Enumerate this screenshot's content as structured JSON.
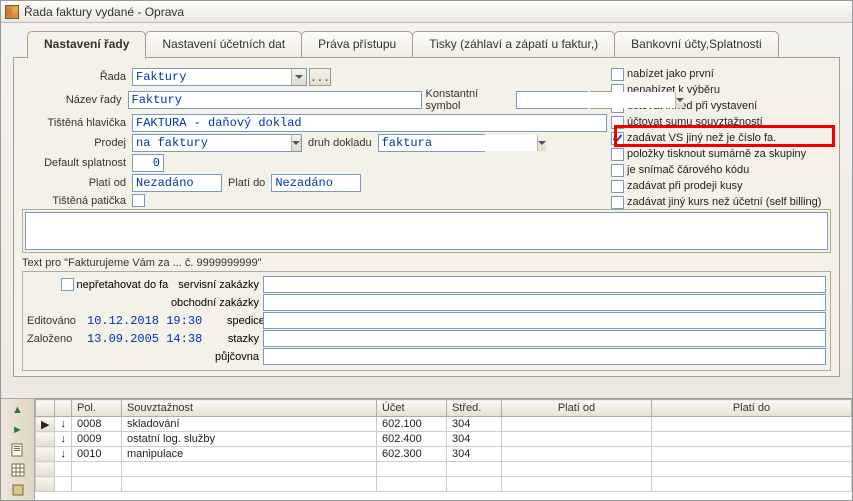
{
  "window_title": "Řada faktury vydané - Oprava",
  "tabs": [
    {
      "label": "Nastavení řady"
    },
    {
      "label": "Nastavení účetních dat"
    },
    {
      "label": "Práva přístupu"
    },
    {
      "label": "Tisky (záhlaví a zápatí u faktur,)"
    },
    {
      "label": "Bankovní účty,Splatnosti"
    }
  ],
  "labels": {
    "rada": "Řada",
    "nazev": "Název řady",
    "tistena": "Tištěná hlavička",
    "prodej": "Prodej",
    "default_splatnost": "Default splatnost",
    "plati_od": "Platí od",
    "plati_do": "Platí do",
    "tistena_paticka": "Tištěná patička",
    "konst_symbol": "Konstantní symbol",
    "druh_dokladu": "druh dokladu",
    "fakturujeme": "Text pro \"Fakturujeme Vám za ...   č. 9999999999\"",
    "nepretahovat": "nepřetahovat do fa",
    "servisni": "servisní zakázky",
    "obchodni": "obchodní zakázky",
    "spedice": "spedice",
    "stazky": "stazky",
    "pujcovna": "půjčovna",
    "editovano": "Editováno",
    "zalozeno": "Založeno"
  },
  "values": {
    "rada": "Faktury",
    "nazev": "Faktury",
    "tistena": "FAKTURA - daňový doklad",
    "prodej": "na faktury",
    "prodej_spin": "1",
    "druh_dokladu": "faktura",
    "druh_spin": "1",
    "default_splatnost": "0",
    "plati_od": "Nezadáno",
    "plati_do": "Nezadáno",
    "editovano": "10.12.2018 19:30",
    "zalozeno": "13.09.2005 14:38"
  },
  "checks": [
    {
      "label": "nabízet jako první",
      "checked": false
    },
    {
      "label": "nenabízet k výběru",
      "checked": false
    },
    {
      "label": "účtovat ihned při vystavení",
      "checked": false
    },
    {
      "label": "účtovat sumu souvztažností",
      "checked": false
    },
    {
      "label": "zadávat VS jiný než je číslo fa.",
      "checked": true
    },
    {
      "label": "položky tisknout sumárně za skupiny",
      "checked": false
    },
    {
      "label": "je snímač čárového kódu",
      "checked": false
    },
    {
      "label": "zadávat při prodeji kusy",
      "checked": false
    },
    {
      "label": "zadávat jiný kurs než účetní (self billing)",
      "checked": false
    }
  ],
  "grid": {
    "headers": [
      "",
      "",
      "Pol.",
      "Souvztažnost",
      "Účet",
      "Střed.",
      "Platí od",
      "Platí do"
    ],
    "rows": [
      {
        "mark": "▶",
        "dir": "↓",
        "pol": "0008",
        "souv": "skladování",
        "ucet": "602.100",
        "stred": "304",
        "od": "",
        "do": ""
      },
      {
        "mark": "",
        "dir": "↓",
        "pol": "0009",
        "souv": "ostatní log. služby",
        "ucet": "602.400",
        "stred": "304",
        "od": "",
        "do": ""
      },
      {
        "mark": "",
        "dir": "↓",
        "pol": "0010",
        "souv": "manipulace",
        "ucet": "602.300",
        "stred": "304",
        "od": "",
        "do": ""
      }
    ]
  }
}
